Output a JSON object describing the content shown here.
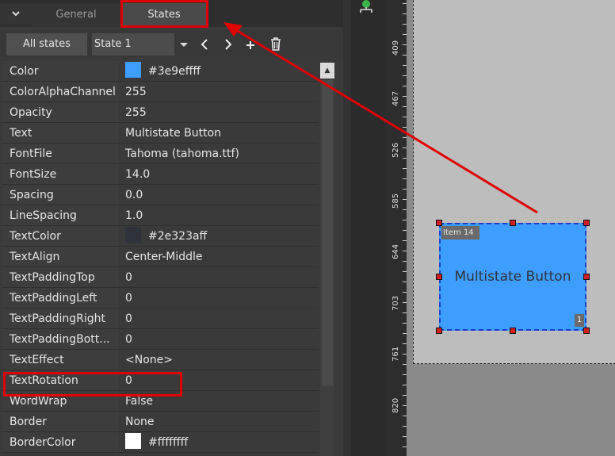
{
  "tabs": {
    "general": "General",
    "states": "States"
  },
  "states_bar": {
    "all_states": "All states",
    "current_state": "State 1"
  },
  "properties": [
    {
      "name": "Color",
      "value": "#3e9effff",
      "swatch": "#3e9eff"
    },
    {
      "name": "ColorAlphaChannel",
      "value": "255"
    },
    {
      "name": "Opacity",
      "value": "255"
    },
    {
      "name": "Text",
      "value": "Multistate Button"
    },
    {
      "name": "FontFile",
      "value": "Tahoma (tahoma.ttf)"
    },
    {
      "name": "FontSize",
      "value": "14.0"
    },
    {
      "name": "Spacing",
      "value": "0.0"
    },
    {
      "name": "LineSpacing",
      "value": "1.0"
    },
    {
      "name": "TextColor",
      "value": "#2e323aff",
      "swatch": "#2e323a"
    },
    {
      "name": "TextAlign",
      "value": "Center-Middle"
    },
    {
      "name": "TextPaddingTop",
      "value": "0"
    },
    {
      "name": "TextPaddingLeft",
      "value": "0"
    },
    {
      "name": "TextPaddingRight",
      "value": "0"
    },
    {
      "name": "TextPaddingBott...",
      "value": "0"
    },
    {
      "name": "TextEffect",
      "value": "<None>"
    },
    {
      "name": "TextRotation",
      "value": "0"
    },
    {
      "name": "WordWrap",
      "value": "False"
    },
    {
      "name": "Border",
      "value": "None"
    },
    {
      "name": "BorderColor",
      "value": "#ffffffff",
      "swatch": "#ffffff"
    }
  ],
  "ruler": {
    "ticks": [
      "409",
      "467",
      "526",
      "585",
      "644",
      "703",
      "761",
      "820"
    ]
  },
  "canvas": {
    "item_label": "Item 14",
    "button_text": "Multistate Button",
    "state_badge": "1"
  },
  "colors": {
    "highlight": "#e00000",
    "button_fill": "#3e9eff",
    "text_color": "#2e323a"
  }
}
